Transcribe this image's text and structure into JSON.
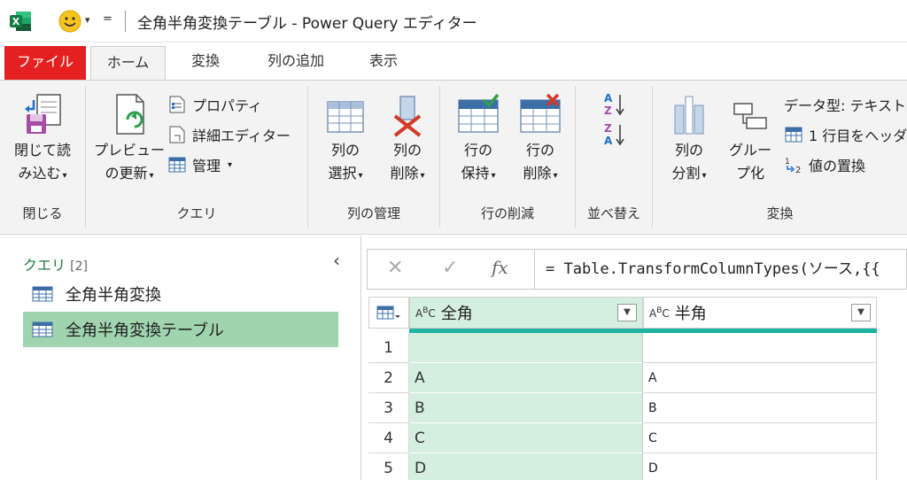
{
  "window": {
    "title": "全角半角変換テーブル - Power Query エディター",
    "qa_dropdown": "▾",
    "qa_customize": "="
  },
  "tabs": [
    {
      "label": "ファイル"
    },
    {
      "label": "ホーム"
    },
    {
      "label": "変換"
    },
    {
      "label": "列の追加"
    },
    {
      "label": "表示"
    }
  ],
  "ribbon": {
    "close": {
      "group_label": "閉じる",
      "close_load_l1": "閉じて読",
      "close_load_l2": "み込む"
    },
    "query": {
      "group_label": "クエリ",
      "preview_l1": "プレビュー",
      "preview_l2": "の更新",
      "properties": "プロパティ",
      "advanced_editor": "詳細エディター",
      "manage": "管理"
    },
    "manage_columns": {
      "group_label": "列の管理",
      "choose_l1": "列の",
      "choose_l2": "選択",
      "remove_l1": "列の",
      "remove_l2": "削除"
    },
    "reduce_rows": {
      "group_label": "行の削減",
      "keep_l1": "行の",
      "keep_l2": "保持",
      "remove_l1": "行の",
      "remove_l2": "削除"
    },
    "sort": {
      "group_label": "並べ替え"
    },
    "transform": {
      "group_label": "変換",
      "split_l1": "列の",
      "split_l2": "分割",
      "group_l1": "グルー",
      "group_l2": "プ化",
      "data_type": "データ型: テキスト",
      "first_row_header": "1 行目をヘッダ",
      "replace_values": "値の置換"
    }
  },
  "queries_pane": {
    "title": "クエリ",
    "count": "[2]",
    "items": [
      {
        "label": "全角半角変換"
      },
      {
        "label": "全角半角変換テーブル"
      }
    ]
  },
  "formula_bar": {
    "cancel": "✕",
    "commit": "✓",
    "fx": "fx",
    "expression": "= Table.TransformColumnTypes(ソース,{{"
  },
  "grid": {
    "columns": [
      {
        "name": "全角",
        "type": "ABC"
      },
      {
        "name": "半角",
        "type": "ABC"
      }
    ],
    "rows": [
      {
        "n": "1",
        "c1": "",
        "c2": ""
      },
      {
        "n": "2",
        "c1": "A",
        "c2": "A"
      },
      {
        "n": "3",
        "c1": "B",
        "c2": "B"
      },
      {
        "n": "4",
        "c1": "C",
        "c2": "C"
      },
      {
        "n": "5",
        "c1": "D",
        "c2": "D"
      }
    ]
  },
  "colors": {
    "file_tab": "#e52020",
    "selected_query": "#9fd4ae",
    "selected_column": "#d4efdf",
    "quality_bar": "#1fb3a0",
    "queries_title": "#1e7a3c"
  }
}
